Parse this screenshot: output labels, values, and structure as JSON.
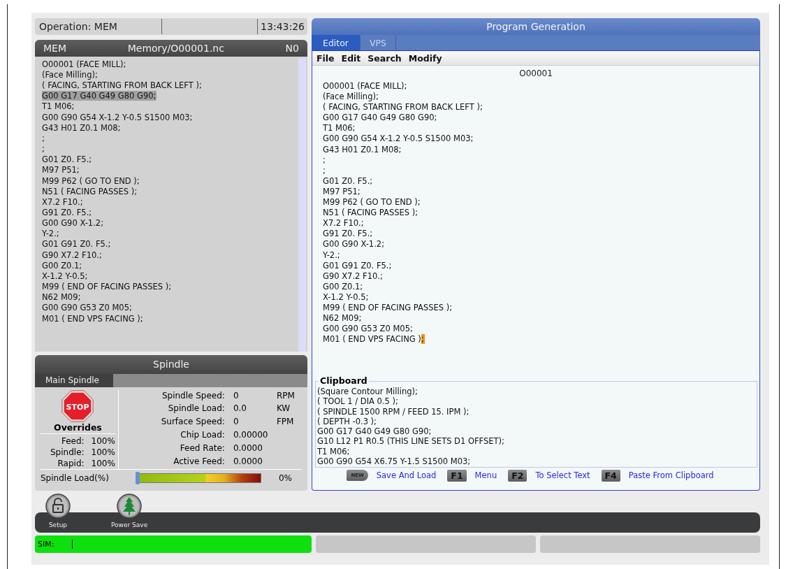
{
  "status_top": {
    "operation": "Operation: MEM",
    "time": "13:43:26"
  },
  "program": {
    "mode": "MEM",
    "path": "Memory/O00001.nc",
    "line_no": "N0",
    "lines": [
      {
        "text": "O00001 (FACE MILL);",
        "selected": false
      },
      {
        "text": "(Face Milling);",
        "selected": false
      },
      {
        "text": "( FACING, STARTING FROM BACK LEFT );",
        "selected": false
      },
      {
        "text": "G00 G17 G40 G49 G80 G90;",
        "selected": true
      },
      {
        "text": "T1 M06;",
        "selected": false
      },
      {
        "text": "G00 G90 G54 X-1.2 Y-0.5 S1500 M03;",
        "selected": false
      },
      {
        "text": "G43 H01 Z0.1 M08;",
        "selected": false
      },
      {
        "text": ";",
        "selected": false
      },
      {
        "text": ";",
        "selected": false
      },
      {
        "text": "G01 Z0. F5.;",
        "selected": false
      },
      {
        "text": "M97 P51;",
        "selected": false
      },
      {
        "text": "M99 P62 ( GO TO END );",
        "selected": false
      },
      {
        "text": "N51 ( FACING PASSES );",
        "selected": false
      },
      {
        "text": "X7.2 F10.;",
        "selected": false
      },
      {
        "text": "G91 Z0. F5.;",
        "selected": false
      },
      {
        "text": "G00 G90 X-1.2;",
        "selected": false
      },
      {
        "text": "Y-2.;",
        "selected": false
      },
      {
        "text": "G01 G91 Z0. F5.;",
        "selected": false
      },
      {
        "text": "G90 X7.2 F10.;",
        "selected": false
      },
      {
        "text": "G00 Z0.1;",
        "selected": false
      },
      {
        "text": "X-1.2 Y-0.5;",
        "selected": false
      },
      {
        "text": "M99 ( END OF FACING PASSES );",
        "selected": false
      },
      {
        "text": "N62 M09;",
        "selected": false
      },
      {
        "text": "G00 G90 G53 Z0 M05;",
        "selected": false
      },
      {
        "text": "M01 ( END VPS FACING );",
        "selected": false
      }
    ]
  },
  "spindle": {
    "title": "Spindle",
    "stop_sign": "STOP",
    "tabs": [
      {
        "label": "Main Spindle",
        "selected": true
      }
    ],
    "overrides_title": "Overrides",
    "overrides": [
      {
        "label": "Feed:",
        "value": "100%"
      },
      {
        "label": "Spindle:",
        "value": "100%"
      },
      {
        "label": "Rapid:",
        "value": "100%"
      }
    ],
    "readings": [
      {
        "label": "Spindle Speed:",
        "value": "0",
        "unit": "RPM"
      },
      {
        "label": "Spindle Load:",
        "value": "0.0",
        "unit": "KW"
      },
      {
        "label": "Surface Speed:",
        "value": "0",
        "unit": "FPM"
      },
      {
        "label": "Chip Load:",
        "value": "0.00000"
      },
      {
        "label": "Feed Rate:",
        "value": "0.0000"
      },
      {
        "label": "Active Feed:",
        "value": "0.0000"
      }
    ],
    "load": {
      "label": "Spindle Load(%)",
      "level": 0,
      "reading": "0%"
    }
  },
  "generation": {
    "title": "Program Generation",
    "tabs": [
      {
        "label": "Editor",
        "selected": true
      },
      {
        "label": "VPS",
        "selected": false
      }
    ],
    "menu": [
      "File",
      "Edit",
      "Search",
      "Modify"
    ],
    "program_name": "O00001",
    "lines": [
      {
        "text": "O00001 (FACE MILL);",
        "cursor": false
      },
      {
        "text": "(Face Milling);",
        "cursor": false
      },
      {
        "text": "( FACING, STARTING FROM BACK LEFT );",
        "cursor": false
      },
      {
        "text": "G00 G17 G40 G49 G80 G90;",
        "cursor": false
      },
      {
        "text": "T1 M06;",
        "cursor": false
      },
      {
        "text": "G00 G90 G54 X-1.2 Y-0.5 S1500 M03;",
        "cursor": false
      },
      {
        "text": "G43 H01 Z0.1 M08;",
        "cursor": false
      },
      {
        "text": ";",
        "cursor": false
      },
      {
        "text": ";",
        "cursor": false
      },
      {
        "text": "G01 Z0. F5.;",
        "cursor": false
      },
      {
        "text": "M97 P51;",
        "cursor": false
      },
      {
        "text": "M99 P62 ( GO TO END );",
        "cursor": false
      },
      {
        "text": "N51 ( FACING PASSES );",
        "cursor": false
      },
      {
        "text": "X7.2 F10.;",
        "cursor": false
      },
      {
        "text": "G91 Z0. F5.;",
        "cursor": false
      },
      {
        "text": "G00 G90 X-1.2;",
        "cursor": false
      },
      {
        "text": "Y-2.;",
        "cursor": false
      },
      {
        "text": "G01 G91 Z0. F5.;",
        "cursor": false
      },
      {
        "text": "G90 X7.2 F10.;",
        "cursor": false
      },
      {
        "text": "G00 Z0.1;",
        "cursor": false
      },
      {
        "text": "X-1.2 Y-0.5;",
        "cursor": false
      },
      {
        "text": "M99 ( END OF FACING PASSES );",
        "cursor": false
      },
      {
        "text": "N62 M09;",
        "cursor": false
      },
      {
        "text": "G00 G90 G53 Z0 M05;",
        "cursor": false
      },
      {
        "text": "M01 ( END VPS FACING );",
        "cursor": true
      }
    ],
    "clipboard": {
      "title": "Clipboard",
      "lines": [
        "(Square Contour Milling);",
        "( TOOL 1 / DIA 0.5 );",
        "( SPINDLE 1500 RPM / FEED 15. IPM );",
        "( DEPTH -0.3 );",
        "G00 G17 G40 G49 G80 G90;",
        "G10 L12 P1 R0.5 (THIS LINE SETS D1 OFFSET);",
        "T1 M06;",
        "G00 G90 G54 X6.75 Y-1.5 S1500 M03;"
      ]
    },
    "keys": [
      {
        "key": "NEW",
        "label": "Save And Load"
      },
      {
        "key": "F1",
        "label": "Menu"
      },
      {
        "key": "F2",
        "label": "To Select Text"
      },
      {
        "key": "F4",
        "label": "Paste From Clipboard"
      }
    ]
  },
  "toolbar": [
    {
      "kind": "lock",
      "label": "Setup"
    },
    {
      "kind": "tree",
      "label": "Power Save"
    }
  ],
  "status_bottom": {
    "mode": "SIM:"
  }
}
